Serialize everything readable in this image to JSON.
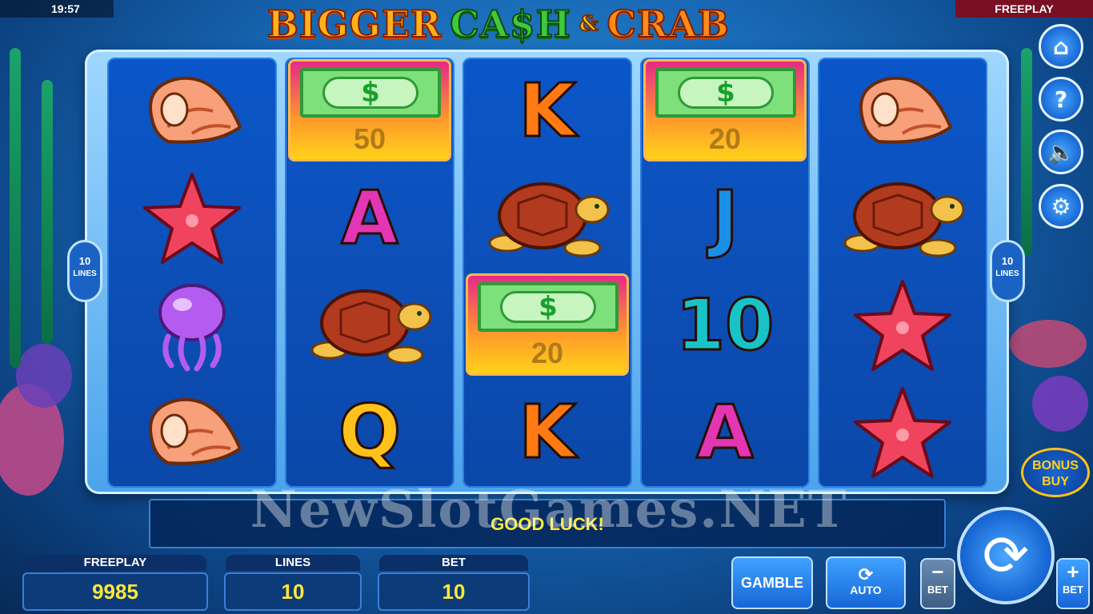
{
  "status": {
    "time": "19:57",
    "mode": "FREEPLAY"
  },
  "logo": {
    "word1": "BIGGER",
    "word2": "CA$H",
    "amp": "&",
    "word3": "CRAB"
  },
  "side_badges": {
    "lines_count": "10",
    "lines_word": "LINES"
  },
  "reels": [
    [
      {
        "type": "icon",
        "name": "conch-shell"
      },
      {
        "type": "icon",
        "name": "starfish"
      },
      {
        "type": "icon",
        "name": "jellyfish"
      },
      {
        "type": "icon",
        "name": "conch-shell"
      }
    ],
    [
      {
        "type": "cash",
        "value": "50"
      },
      {
        "type": "letter",
        "text": "A"
      },
      {
        "type": "icon",
        "name": "sea-turtle"
      },
      {
        "type": "letter",
        "text": "Q"
      }
    ],
    [
      {
        "type": "letter",
        "text": "K"
      },
      {
        "type": "icon",
        "name": "sea-turtle"
      },
      {
        "type": "cash",
        "value": "20"
      },
      {
        "type": "letter",
        "text": "K"
      }
    ],
    [
      {
        "type": "cash",
        "value": "20"
      },
      {
        "type": "letter",
        "text": "J"
      },
      {
        "type": "letter",
        "text": "10"
      },
      {
        "type": "letter",
        "text": "A"
      }
    ],
    [
      {
        "type": "icon",
        "name": "conch-shell"
      },
      {
        "type": "icon",
        "name": "sea-turtle"
      },
      {
        "type": "icon",
        "name": "starfish"
      },
      {
        "type": "icon",
        "name": "starfish"
      }
    ]
  ],
  "cash_symbol": {
    "bill_sign": "$"
  },
  "message": "GOOD LUCK!",
  "watermark": "NewSlotGames.NET",
  "stats": {
    "freeplay": {
      "label": "FREEPLAY",
      "value": "9985"
    },
    "lines": {
      "label": "LINES",
      "value": "10"
    },
    "bet": {
      "label": "BET",
      "value": "10"
    }
  },
  "controls": {
    "gamble_label": "GAMBLE",
    "auto_label": "AUTO",
    "bet_minus_label": "BET",
    "bet_plus_label": "BET",
    "minus_glyph": "−",
    "plus_glyph": "+",
    "spin_icon": "refresh-arrows-icon",
    "bonus_buy_line1": "BONUS",
    "bonus_buy_line2": "BUY"
  },
  "side_menu": [
    {
      "name": "home-icon",
      "glyph": "⌂"
    },
    {
      "name": "help-icon",
      "glyph": "?"
    },
    {
      "name": "sound-muted-icon",
      "glyph": "🔈"
    },
    {
      "name": "settings-gear-icon",
      "glyph": "⚙"
    }
  ]
}
